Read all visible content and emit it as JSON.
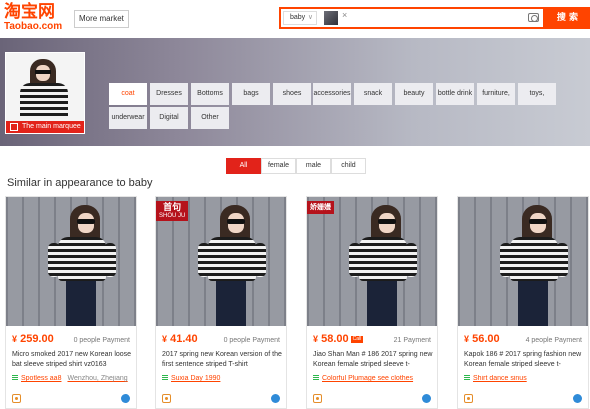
{
  "header": {
    "logo_cn": "淘宝网",
    "logo_en": "Taobao.com",
    "more_market": "More market",
    "search_scope": "baby",
    "search_button": "搜 索"
  },
  "banner": {
    "marquee_label": "The main marquee",
    "categories": [
      "coat",
      "Dresses",
      "Bottoms",
      "bags",
      "shoes",
      "accessories",
      "snack",
      "beauty",
      "bottle drink",
      "furniture,",
      "toys,",
      "underwear",
      "Digital",
      "Other"
    ],
    "active_category": "coat"
  },
  "filters": {
    "items": [
      "All",
      "female",
      "male",
      "child"
    ],
    "active": "All"
  },
  "section_title": "Similar in appearance to baby",
  "products": [
    {
      "price": "259.00",
      "currency": "¥",
      "payment": "0 people Payment",
      "title": "Micro smoked 2017 new Korean loose bat sleeve striped shirt vz0163",
      "shop": "Spotless aa8",
      "location": "Wenzhou, Zhejiang",
      "tag": "",
      "tag_sub": ""
    },
    {
      "price": "41.40",
      "currency": "¥",
      "payment": "0 people Payment",
      "title": "2017 spring new Korean version of the first sentence striped T-shirt",
      "shop": "Suxia Day 1990",
      "location": "",
      "tag": "首句",
      "tag_sub": "SHOU JU"
    },
    {
      "price": "58.00",
      "currency": "¥",
      "payment": "21 Payment",
      "title": "Jiao Shan Man # 186 2017 spring new Korean female striped sleeve t-",
      "shop": "Colorful Plumage see clothes",
      "location": "",
      "tag": "娇姗嫚",
      "tag_sub": "",
      "badge": "Call"
    },
    {
      "price": "56.00",
      "currency": "¥",
      "payment": "4 people Payment",
      "title": "Kapok 186 # 2017 spring fashion new Korean female striped sleeve t-",
      "shop": "Shirt dance sinus",
      "location": "",
      "tag": "",
      "tag_sub": ""
    }
  ],
  "colors": {
    "brand": "#ff4400",
    "active_red": "#e2231a",
    "banner_start": "#6a6478",
    "banner_end": "#c8cbd3"
  }
}
